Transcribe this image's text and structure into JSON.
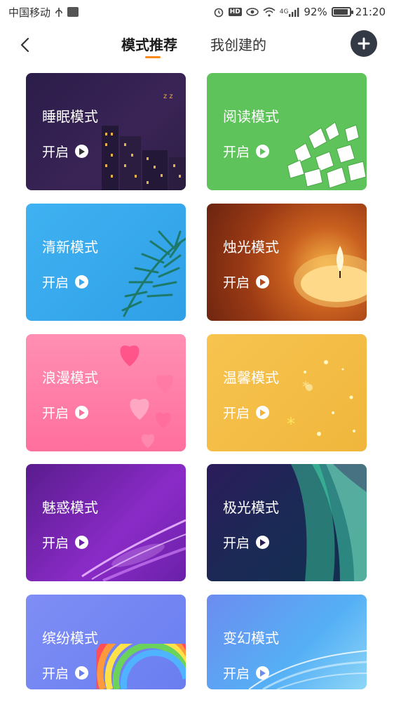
{
  "status_bar": {
    "carrier": "中国移动",
    "battery": "92%",
    "battery_level": 0.92,
    "time": "21:20",
    "network": "4G"
  },
  "header": {
    "tabs": [
      {
        "label": "模式推荐",
        "active": true
      },
      {
        "label": "我创建的",
        "active": false
      }
    ],
    "accent_color": "#ff8a1c"
  },
  "modes": [
    {
      "title": "睡眠模式",
      "action": "开启"
    },
    {
      "title": "阅读模式",
      "action": "开启"
    },
    {
      "title": "清新模式",
      "action": "开启"
    },
    {
      "title": "烛光模式",
      "action": "开启"
    },
    {
      "title": "浪漫模式",
      "action": "开启"
    },
    {
      "title": "温馨模式",
      "action": "开启"
    },
    {
      "title": "魅惑模式",
      "action": "开启"
    },
    {
      "title": "极光模式",
      "action": "开启"
    },
    {
      "title": "缤纷模式",
      "action": "开启"
    },
    {
      "title": "变幻模式",
      "action": "开启"
    }
  ]
}
